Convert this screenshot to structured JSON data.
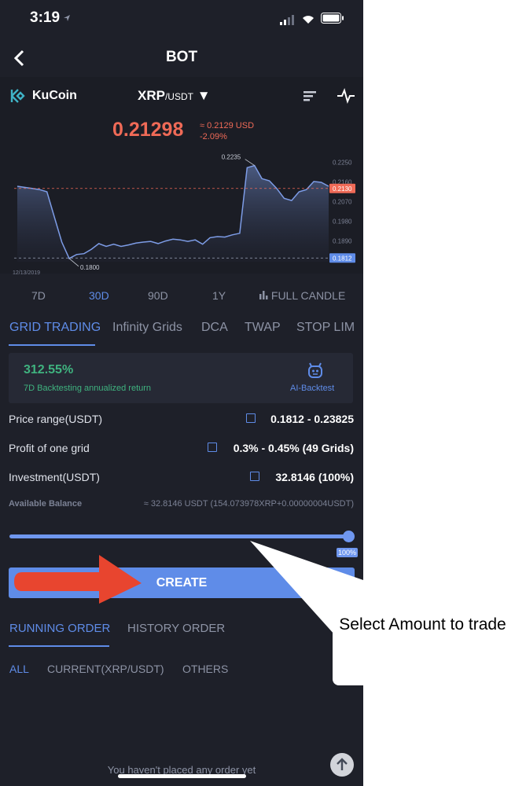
{
  "status": {
    "time": "3:19"
  },
  "nav": {
    "title": "BOT"
  },
  "exchange": {
    "name": "KuCoin"
  },
  "pair": {
    "base": "XRP",
    "quote": "/USDT",
    "arrow": "▼"
  },
  "price": {
    "last": "0.21298",
    "usd": "≈ 0.2129 USD",
    "change": "-2.09%"
  },
  "chart_data": {
    "type": "line",
    "date_label": "12/13/2019",
    "y_ticks": [
      "0.2250",
      "0.2160",
      "0.2130",
      "0.2070",
      "0.1980",
      "0.1890",
      "0.1812"
    ],
    "high_label": "0.2235",
    "low_label": "0.1800",
    "current_tag": "0.2130",
    "low_tag": "0.1812",
    "values": [
      0.214,
      0.2135,
      0.213,
      0.2125,
      0.2115,
      0.2,
      0.1885,
      0.181,
      0.1828,
      0.1832,
      0.1852,
      0.1878,
      0.1865,
      0.1875,
      0.1865,
      0.1872,
      0.188,
      0.1885,
      0.1888,
      0.1878,
      0.189,
      0.1898,
      0.1895,
      0.1888,
      0.1895,
      0.1875,
      0.1905,
      0.191,
      0.1908,
      0.1918,
      0.1925,
      0.2225,
      0.2235,
      0.2175,
      0.2165,
      0.213,
      0.2085,
      0.2075,
      0.2115,
      0.2125,
      0.2162,
      0.2158,
      0.214
    ],
    "ylim": [
      0.1795,
      0.2255
    ]
  },
  "periods": {
    "p1": "7D",
    "p2": "30D",
    "p3": "90D",
    "p4": "1Y",
    "full": "FULL CANDLE"
  },
  "tabs": {
    "t1": "GRID TRADING",
    "t2": "Infinity Grids",
    "t3": "DCA",
    "t4": "TWAP",
    "t5": "STOP LIM"
  },
  "backtest": {
    "return": "312.55%",
    "label": "7D Backtesting annualized return",
    "ai": "AI-Backtest"
  },
  "params": {
    "range_label": "Price range(USDT)",
    "range_value": "0.1812 - 0.23825",
    "profit_label": "Profit of one grid",
    "profit_value": "0.3% - 0.45% (49 Grids)",
    "invest_label": "Investment(USDT)",
    "invest_value": "32.8146 (100%)"
  },
  "balance": {
    "label": "Available Balance",
    "value": "≈ 32.8146 USDT (154.073978XRP+0.00000004USDT)"
  },
  "slider": {
    "percent": "100%",
    "level": 1.0
  },
  "create": {
    "label": "CREATE"
  },
  "orders": {
    "running": "RUNNING ORDER",
    "history": "HISTORY ORDER"
  },
  "filters": {
    "all": "ALL",
    "current": "CURRENT(XRP/USDT)",
    "others": "OTHERS"
  },
  "empty": {
    "text": "You haven't placed any order yet"
  },
  "callout": {
    "text": "Select Amount to trade"
  },
  "colors": {
    "accent": "#5f8ce8",
    "down": "#ef6a57",
    "up": "#3fb37f",
    "background": "#1e2029"
  }
}
